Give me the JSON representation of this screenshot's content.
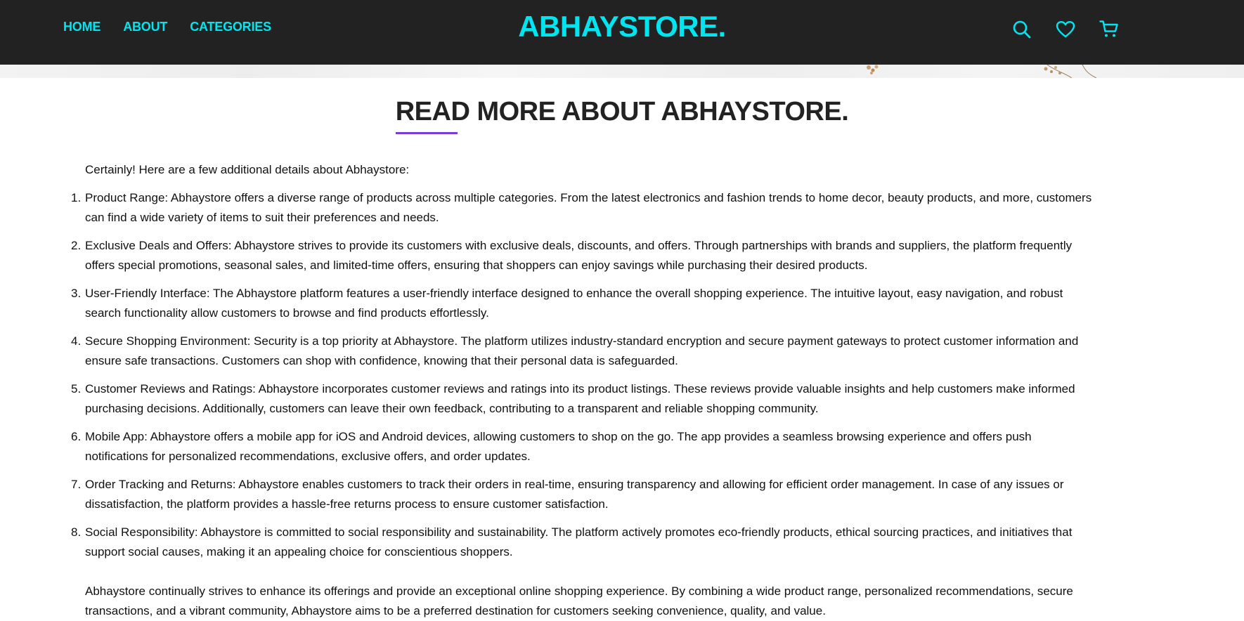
{
  "nav": {
    "links": [
      "HOME",
      "ABOUT",
      "CATEGORIES"
    ],
    "brand": "ABHAYSTORE.",
    "icons": [
      "search-icon",
      "heart-icon",
      "cart-icon"
    ],
    "accent_color": "#00e5ef",
    "background_color": "#222222"
  },
  "main": {
    "title": "READ MORE ABOUT ABHAYSTORE.",
    "underline_color": "#7a3bd8",
    "intro": "Certainly! Here are a few additional details about Abhaystore:",
    "items": [
      {
        "num": "1.",
        "text": "Product Range: Abhaystore offers a diverse range of products across multiple categories. From the latest electronics and fashion trends to home decor, beauty products, and more, customers can find a wide variety of items to suit their preferences and needs."
      },
      {
        "num": "2.",
        "text": "Exclusive Deals and Offers: Abhaystore strives to provide its customers with exclusive deals, discounts, and offers. Through partnerships with brands and suppliers, the platform frequently offers special promotions, seasonal sales, and limited-time offers, ensuring that shoppers can enjoy savings while purchasing their desired products."
      },
      {
        "num": "3.",
        "text": "User-Friendly Interface: The Abhaystore platform features a user-friendly interface designed to enhance the overall shopping experience. The intuitive layout, easy navigation, and robust search functionality allow customers to browse and find products effortlessly."
      },
      {
        "num": "4.",
        "text": "Secure Shopping Environment: Security is a top priority at Abhaystore. The platform utilizes industry-standard encryption and secure payment gateways to protect customer information and ensure safe transactions. Customers can shop with confidence, knowing that their personal data is safeguarded."
      },
      {
        "num": "5.",
        "text": "Customer Reviews and Ratings: Abhaystore incorporates customer reviews and ratings into its product listings. These reviews provide valuable insights and help customers make informed purchasing decisions. Additionally, customers can leave their own feedback, contributing to a transparent and reliable shopping community."
      },
      {
        "num": "6.",
        "text": "Mobile App: Abhaystore offers a mobile app for iOS and Android devices, allowing customers to shop on the go. The app provides a seamless browsing experience and offers push notifications for personalized recommendations, exclusive offers, and order updates."
      },
      {
        "num": "7.",
        "text": "Order Tracking and Returns: Abhaystore enables customers to track their orders in real-time, ensuring transparency and allowing for efficient order management. In case of any issues or dissatisfaction, the platform provides a hassle-free returns process to ensure customer satisfaction."
      },
      {
        "num": "8.",
        "text": "Social Responsibility: Abhaystore is committed to social responsibility and sustainability. The platform actively promotes eco-friendly products, ethical sourcing practices, and initiatives that support social causes, making it an appealing choice for conscientious shoppers."
      }
    ],
    "closing": "Abhaystore continually strives to enhance its offerings and provide an exceptional online shopping experience. By combining a wide product range, personalized recommendations, secure transactions, and a vibrant community, Abhaystore aims to be a preferred destination for customers seeking convenience, quality, and value."
  }
}
